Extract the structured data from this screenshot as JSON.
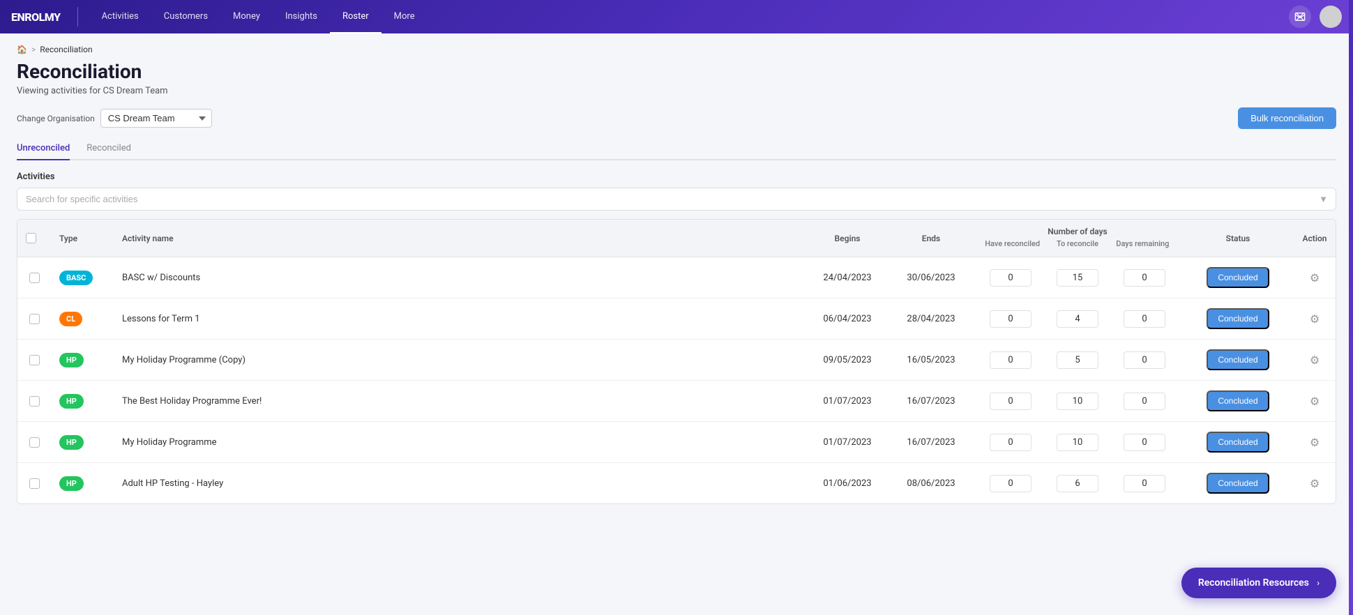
{
  "app": {
    "logo_main": "ENROLMY",
    "logo_accent": ""
  },
  "nav": {
    "items": [
      {
        "label": "Activities",
        "active": false
      },
      {
        "label": "Customers",
        "active": false
      },
      {
        "label": "Money",
        "active": false
      },
      {
        "label": "Insights",
        "active": false
      },
      {
        "label": "Roster",
        "active": true
      },
      {
        "label": "More",
        "active": false
      }
    ]
  },
  "breadcrumb": {
    "home_label": "🏠",
    "separator": ">",
    "current": "Reconciliation"
  },
  "page": {
    "title": "Reconciliation",
    "subtitle": "Viewing activities for CS Dream Team"
  },
  "controls": {
    "org_label": "Change Organisation",
    "org_value": "CS Dream Team",
    "bulk_recon_label": "Bulk reconciliation"
  },
  "tabs": [
    {
      "label": "Unreconciled",
      "active": true
    },
    {
      "label": "Reconciled",
      "active": false
    }
  ],
  "activities_section": {
    "label": "Activities",
    "search_placeholder": "Search for specific activities"
  },
  "table": {
    "columns": {
      "type": "Type",
      "activity_name": "Activity name",
      "begins": "Begins",
      "ends": "Ends",
      "number_of_days": "Number of days",
      "days_sub": [
        "Have reconciled",
        "To reconcile",
        "Days remaining"
      ],
      "status": "Status",
      "action": "Action"
    },
    "rows": [
      {
        "id": 1,
        "type": "BASC",
        "type_color": "basc",
        "activity_name": "BASC w/ Discounts",
        "begins": "24/04/2023",
        "ends": "30/06/2023",
        "have_reconciled": 0,
        "to_reconcile": 15,
        "days_remaining": 0,
        "status": "Concluded"
      },
      {
        "id": 2,
        "type": "CL",
        "type_color": "cl",
        "activity_name": "Lessons for Term 1",
        "begins": "06/04/2023",
        "ends": "28/04/2023",
        "have_reconciled": 0,
        "to_reconcile": 4,
        "days_remaining": 0,
        "status": "Concluded"
      },
      {
        "id": 3,
        "type": "HP",
        "type_color": "hp",
        "activity_name": "My Holiday Programme (Copy)",
        "begins": "09/05/2023",
        "ends": "16/05/2023",
        "have_reconciled": 0,
        "to_reconcile": 5,
        "days_remaining": 0,
        "status": "Concluded"
      },
      {
        "id": 4,
        "type": "HP",
        "type_color": "hp",
        "activity_name": "The Best Holiday Programme Ever!",
        "begins": "01/07/2023",
        "ends": "16/07/2023",
        "have_reconciled": 0,
        "to_reconcile": 10,
        "days_remaining": 0,
        "status": "Concluded"
      },
      {
        "id": 5,
        "type": "HP",
        "type_color": "hp",
        "activity_name": "My Holiday Programme",
        "begins": "01/07/2023",
        "ends": "16/07/2023",
        "have_reconciled": 0,
        "to_reconcile": 10,
        "days_remaining": 0,
        "status": "Concluded"
      },
      {
        "id": 6,
        "type": "HP",
        "type_color": "hp",
        "activity_name": "Adult HP Testing - Hayley",
        "begins": "01/06/2023",
        "ends": "08/06/2023",
        "have_reconciled": 0,
        "to_reconcile": 6,
        "days_remaining": 0,
        "status": "Concluded"
      }
    ]
  },
  "floating_btn": {
    "label": "Reconciliation Resources"
  }
}
